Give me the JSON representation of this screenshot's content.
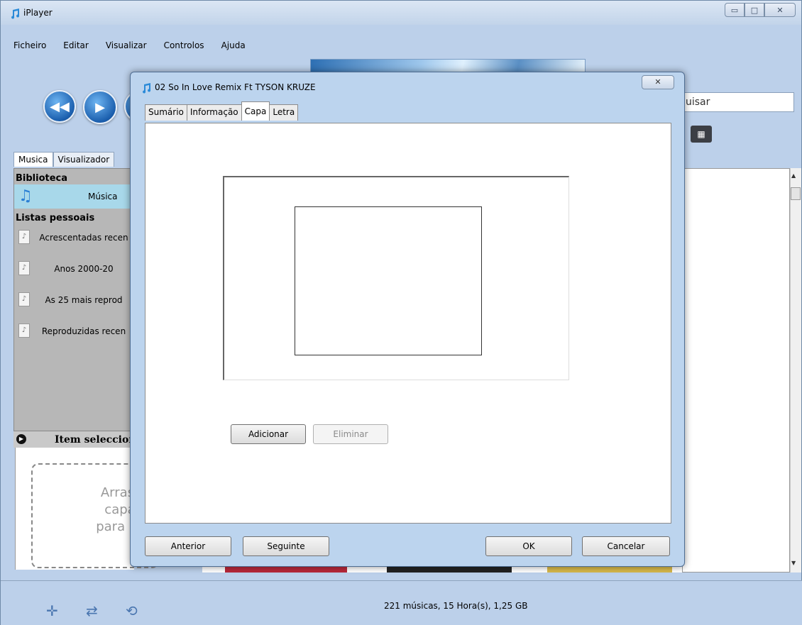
{
  "window": {
    "title": "iPlayer"
  },
  "menu": [
    "Ficheiro",
    "Editar",
    "Visualizar",
    "Controlos",
    "Ajuda"
  ],
  "search": {
    "visible_text": "uisar"
  },
  "left_tabs": [
    "Musica",
    "Visualizador"
  ],
  "sidebar": {
    "library_title": "Biblioteca",
    "library_item": "Música",
    "playlists_title": "Listas pessoais",
    "playlists": [
      "Acrescentadas recen",
      "Anos 2000-20",
      "As 25 mais reprod",
      "Reproduzidas recen"
    ]
  },
  "selected_item": {
    "title": "Item seleccion",
    "drop_text": [
      "Arrast",
      "capa",
      "para ac"
    ]
  },
  "status": {
    "summary": "221 músicas, 15 Hora(s), 1,25 GB"
  },
  "dialog": {
    "title": "02 So In Love Remix Ft TYSON KRUZE",
    "tabs": [
      "Sumário",
      "Informação",
      "Capa",
      "Letra"
    ],
    "active_tab": "Capa",
    "add_button": "Adicionar",
    "remove_button": "Eliminar",
    "prev_button": "Anterior",
    "next_button": "Seguinte",
    "ok_button": "OK",
    "cancel_button": "Cancelar"
  },
  "icons": {
    "app": "music-note-icon",
    "close": "close-icon",
    "minimize": "minimize-icon",
    "maximize": "maximize-icon",
    "rewind": "rewind-icon",
    "play": "play-icon",
    "grid": "grid-view-icon",
    "add": "add-icon",
    "shuffle": "shuffle-icon",
    "repeat": "repeat-icon"
  },
  "colors": {
    "accent": "#1b5fae",
    "library_highlight": "#a8d8ea",
    "window_bg": "#bcd0ea"
  }
}
